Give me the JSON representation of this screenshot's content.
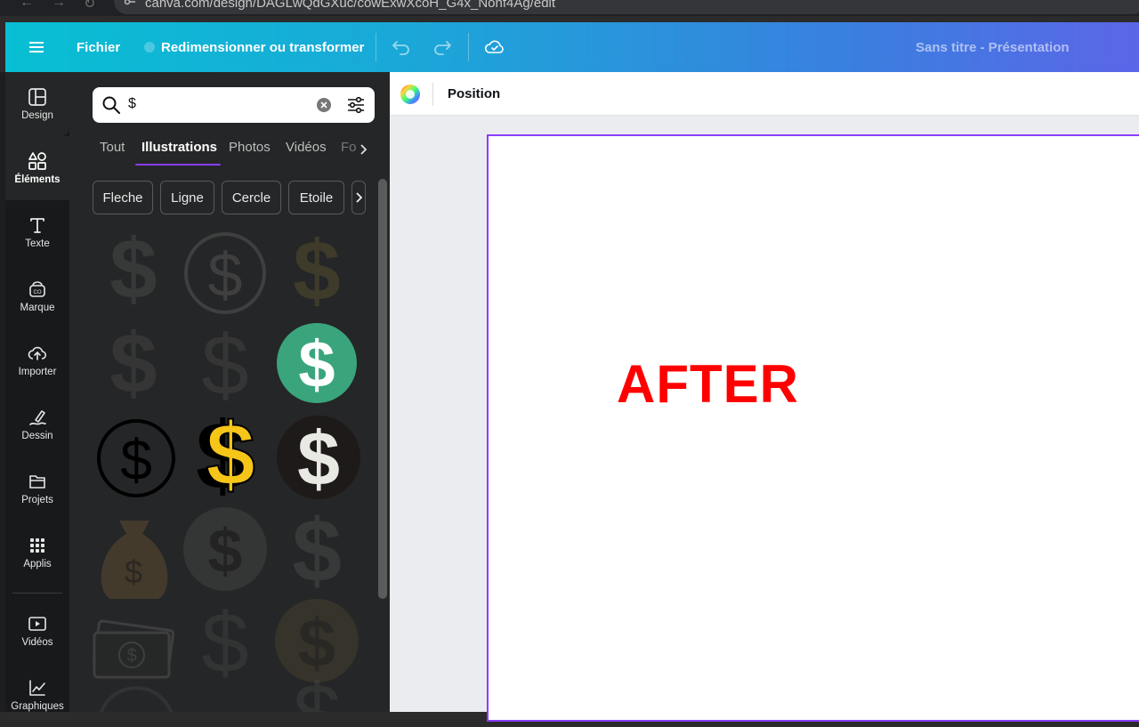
{
  "browser": {
    "url": "canva.com/design/DAGLwQdGXuc/cowExwXcoH_G4x_Nonf4Ag/edit"
  },
  "topbar": {
    "menu_icon": "hamburger-icon",
    "file_label": "Fichier",
    "resize_label": "Redimensionner ou transformer",
    "undo_icon": "undo-icon",
    "redo_icon": "redo-icon",
    "cloud_icon": "cloud-saved-icon",
    "doc_title": "Sans titre - Présentation"
  },
  "rail": {
    "items": [
      {
        "label": "Design",
        "icon": "layout-icon"
      },
      {
        "label": "Éléments",
        "icon": "shapes-icon"
      },
      {
        "label": "Texte",
        "icon": "text-icon"
      },
      {
        "label": "Marque",
        "icon": "brand-icon"
      },
      {
        "label": "Importer",
        "icon": "upload-icon"
      },
      {
        "label": "Dessin",
        "icon": "draw-icon"
      },
      {
        "label": "Projets",
        "icon": "folder-icon"
      },
      {
        "label": "Applis",
        "icon": "apps-icon"
      },
      {
        "label": "Vidéos",
        "icon": "video-icon"
      },
      {
        "label": "Graphiques",
        "icon": "chart-icon"
      }
    ]
  },
  "panel": {
    "search": {
      "value": "$"
    },
    "tabs": [
      "Tout",
      "Illustrations",
      "Photos",
      "Vidéos",
      "Fo"
    ],
    "active_tab": "Illustrations",
    "chips": [
      "Fleche",
      "Ligne",
      "Cercle",
      "Etoile"
    ]
  },
  "context": {
    "position_label": "Position"
  },
  "canvas": {
    "text": "AFTER",
    "text_color": "#ff0000"
  },
  "colors": {
    "accent": "#8b3dff",
    "green_coin": "#3aa57c",
    "gold": "#f5c518"
  }
}
